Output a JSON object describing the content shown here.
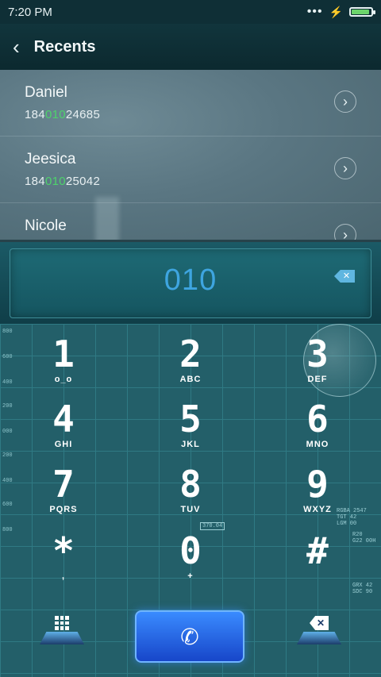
{
  "status": {
    "time": "7:20 PM",
    "battery_level": 0.9
  },
  "header": {
    "title": "Recents"
  },
  "recents": [
    {
      "name": "Daniel",
      "number_prefix": "184",
      "number_match": "010",
      "number_suffix": "24685"
    },
    {
      "name": "Jeesica",
      "number_prefix": "184",
      "number_match": "010",
      "number_suffix": "25042"
    },
    {
      "name": "Nicole",
      "number_prefix": "",
      "number_match": "",
      "number_suffix": ""
    }
  ],
  "dialer": {
    "input": "010"
  },
  "keys": [
    {
      "digit": "1",
      "letters": "o_o"
    },
    {
      "digit": "2",
      "letters": "ABC"
    },
    {
      "digit": "3",
      "letters": "DEF"
    },
    {
      "digit": "4",
      "letters": "GHI"
    },
    {
      "digit": "5",
      "letters": "JKL"
    },
    {
      "digit": "6",
      "letters": "MNO"
    },
    {
      "digit": "7",
      "letters": "PQRS"
    },
    {
      "digit": "8",
      "letters": "TUV"
    },
    {
      "digit": "9",
      "letters": "WXYZ"
    },
    {
      "digit": "*",
      "letters": ","
    },
    {
      "digit": "0",
      "letters": "+"
    },
    {
      "digit": "#",
      "letters": ""
    }
  ],
  "ruler_labels": [
    "800",
    "600",
    "400",
    "200",
    "000",
    "200",
    "400",
    "600",
    "800"
  ],
  "hud_text": {
    "rgba": "RGBA 2547",
    "tgt": "TGT 42",
    "lgm": "LGM 00",
    "r20": "R20",
    "g22": "G22 00H",
    "grx": "GRX 42",
    "sdc": "SDC 90",
    "coord": "370.04"
  },
  "icons": {
    "back": "back-arrow-icon",
    "call": "phone-icon",
    "dialpad": "dialpad-grid-icon",
    "delete": "backspace-icon"
  },
  "colors": {
    "match_highlight": "#4ed36b",
    "dial_digits": "#3ea5e0",
    "call_button": "#2a66e8"
  }
}
